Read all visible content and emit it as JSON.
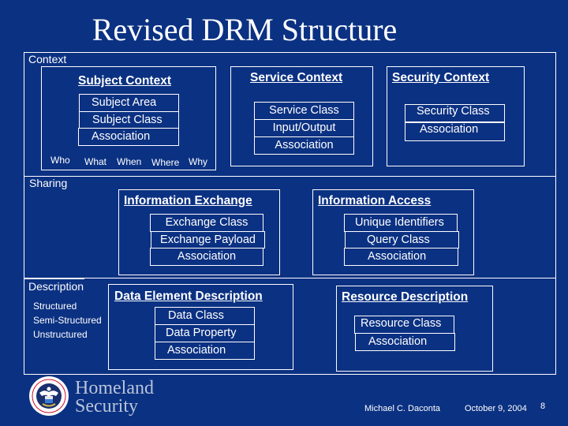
{
  "slide": {
    "title": "Revised DRM Structure",
    "background_color": "#0b3182"
  },
  "context": {
    "label": "Context",
    "subject": {
      "title": "Subject Context",
      "rows": [
        "Subject Area",
        "Subject Class",
        "Association"
      ],
      "questions": [
        "Who",
        "What",
        "When",
        "Where",
        "Why"
      ]
    },
    "service": {
      "title": "Service Context",
      "rows": [
        "Service Class",
        "Input/Output",
        "Association"
      ]
    },
    "security": {
      "title": "Security Context",
      "rows": [
        "Security Class",
        "Association"
      ]
    }
  },
  "sharing": {
    "label": "Sharing",
    "exchange": {
      "title": "Information Exchange",
      "rows": [
        "Exchange Class",
        "Exchange Payload",
        "Association"
      ]
    },
    "access": {
      "title": "Information Access",
      "rows": [
        "Unique Identifiers",
        "Query Class",
        "Association"
      ]
    }
  },
  "description": {
    "label": "Description",
    "types": [
      "Structured",
      "Semi-Structured",
      "Unstructured"
    ],
    "data_element": {
      "title": "Data Element Description",
      "rows": [
        "Data Class",
        "Data Property",
        "Association"
      ]
    },
    "resource": {
      "title": "Resource Description",
      "rows": [
        "Resource Class",
        "Association"
      ]
    }
  },
  "footer": {
    "logo_line1": "Homeland",
    "logo_line2": "Security",
    "logo_icon": "dhs-seal-icon",
    "author": "Michael C. Daconta",
    "date": "October 9, 2004",
    "page_number": "8"
  }
}
